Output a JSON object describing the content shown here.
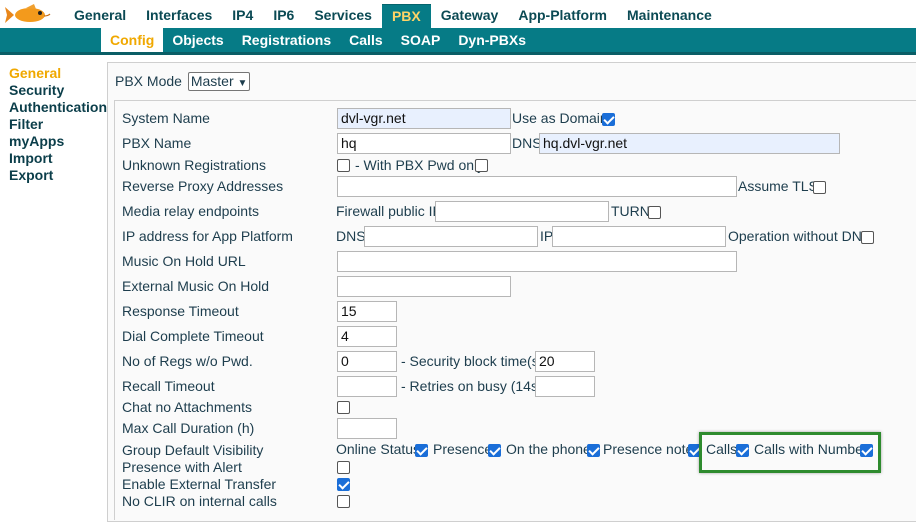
{
  "nav": {
    "main_tabs": [
      {
        "label": "General"
      },
      {
        "label": "Interfaces"
      },
      {
        "label": "IP4"
      },
      {
        "label": "IP6"
      },
      {
        "label": "Services"
      },
      {
        "label": "PBX"
      },
      {
        "label": "Gateway"
      },
      {
        "label": "App-Platform"
      },
      {
        "label": "Maintenance"
      }
    ],
    "active_main": "PBX",
    "sub_tabs": [
      {
        "label": "Config"
      },
      {
        "label": "Objects"
      },
      {
        "label": "Registrations"
      },
      {
        "label": "Calls"
      },
      {
        "label": "SOAP"
      },
      {
        "label": "Dyn-PBXs"
      }
    ],
    "active_sub": "Config"
  },
  "sidebar": {
    "items": [
      {
        "label": "General"
      },
      {
        "label": "Security"
      },
      {
        "label": "Authentication"
      },
      {
        "label": "Filter"
      },
      {
        "label": "myApps"
      },
      {
        "label": "Import"
      },
      {
        "label": "Export"
      }
    ],
    "active": "General"
  },
  "pbx_mode": {
    "label": "PBX Mode",
    "value": "Master"
  },
  "form": {
    "system_name": {
      "label": "System Name",
      "value": "dvl-vgr.net",
      "use_as_domain_label": "Use as Domain",
      "use_as_domain": true
    },
    "pbx_name": {
      "label": "PBX Name",
      "value": "hq",
      "dns_label": "DNS",
      "dns_value": "hq.dvl-vgr.net"
    },
    "unknown_registrations": {
      "label": "Unknown Registrations",
      "checked": false,
      "with_pwd_label": "- With PBX Pwd only",
      "with_pwd_checked": false
    },
    "reverse_proxy": {
      "label": "Reverse Proxy Addresses",
      "value": "",
      "assume_tls_label": "Assume TLS",
      "assume_tls": false
    },
    "media_relay": {
      "label": "Media relay endpoints",
      "firewall_label": "Firewall public IP",
      "firewall_value": "",
      "turn_label": "TURN",
      "turn": false
    },
    "app_platform_ip": {
      "label": "IP address for App Platform",
      "dns_label": "DNS",
      "dns_value": "",
      "ip_label": "IP",
      "ip_value": "",
      "no_dns_label": "Operation without DNS",
      "no_dns": false
    },
    "moh_url": {
      "label": "Music On Hold URL",
      "value": ""
    },
    "ext_moh": {
      "label": "External Music On Hold",
      "value": ""
    },
    "response_timeout": {
      "label": "Response Timeout",
      "value": "15"
    },
    "dial_complete_timeout": {
      "label": "Dial Complete Timeout",
      "value": "4"
    },
    "regs_wo_pwd": {
      "label": "No of Regs w/o Pwd.",
      "value": "0",
      "security_label": "- Security block time(s)",
      "security_value": "20"
    },
    "recall_timeout": {
      "label": "Recall Timeout",
      "value": "",
      "retries_label": "- Retries on busy (14s)",
      "retries_value": ""
    },
    "chat_no_attachments": {
      "label": "Chat no Attachments",
      "checked": false
    },
    "max_call_duration": {
      "label": "Max Call Duration (h)",
      "value": ""
    },
    "group_visibility": {
      "label": "Group Default Visibility",
      "items": [
        {
          "label": "Online Status",
          "checked": true
        },
        {
          "label": "Presence",
          "checked": true
        },
        {
          "label": "On the phone",
          "checked": true
        },
        {
          "label": "Presence note",
          "checked": true
        },
        {
          "label": "Calls",
          "checked": true
        },
        {
          "label": "Calls with Number",
          "checked": true
        }
      ]
    },
    "presence_alert": {
      "label": "Presence with Alert",
      "checked": false
    },
    "external_transfer": {
      "label": "Enable External Transfer",
      "checked": true
    },
    "no_clir": {
      "label": "No CLIR on internal calls",
      "checked": false
    }
  },
  "colors": {
    "accent": "#067b86",
    "active_tab_text": "#ffd466",
    "active_sub_text": "#f0a800",
    "highlight": "#2e8b2e",
    "checkbox": "#1a6ed8"
  }
}
